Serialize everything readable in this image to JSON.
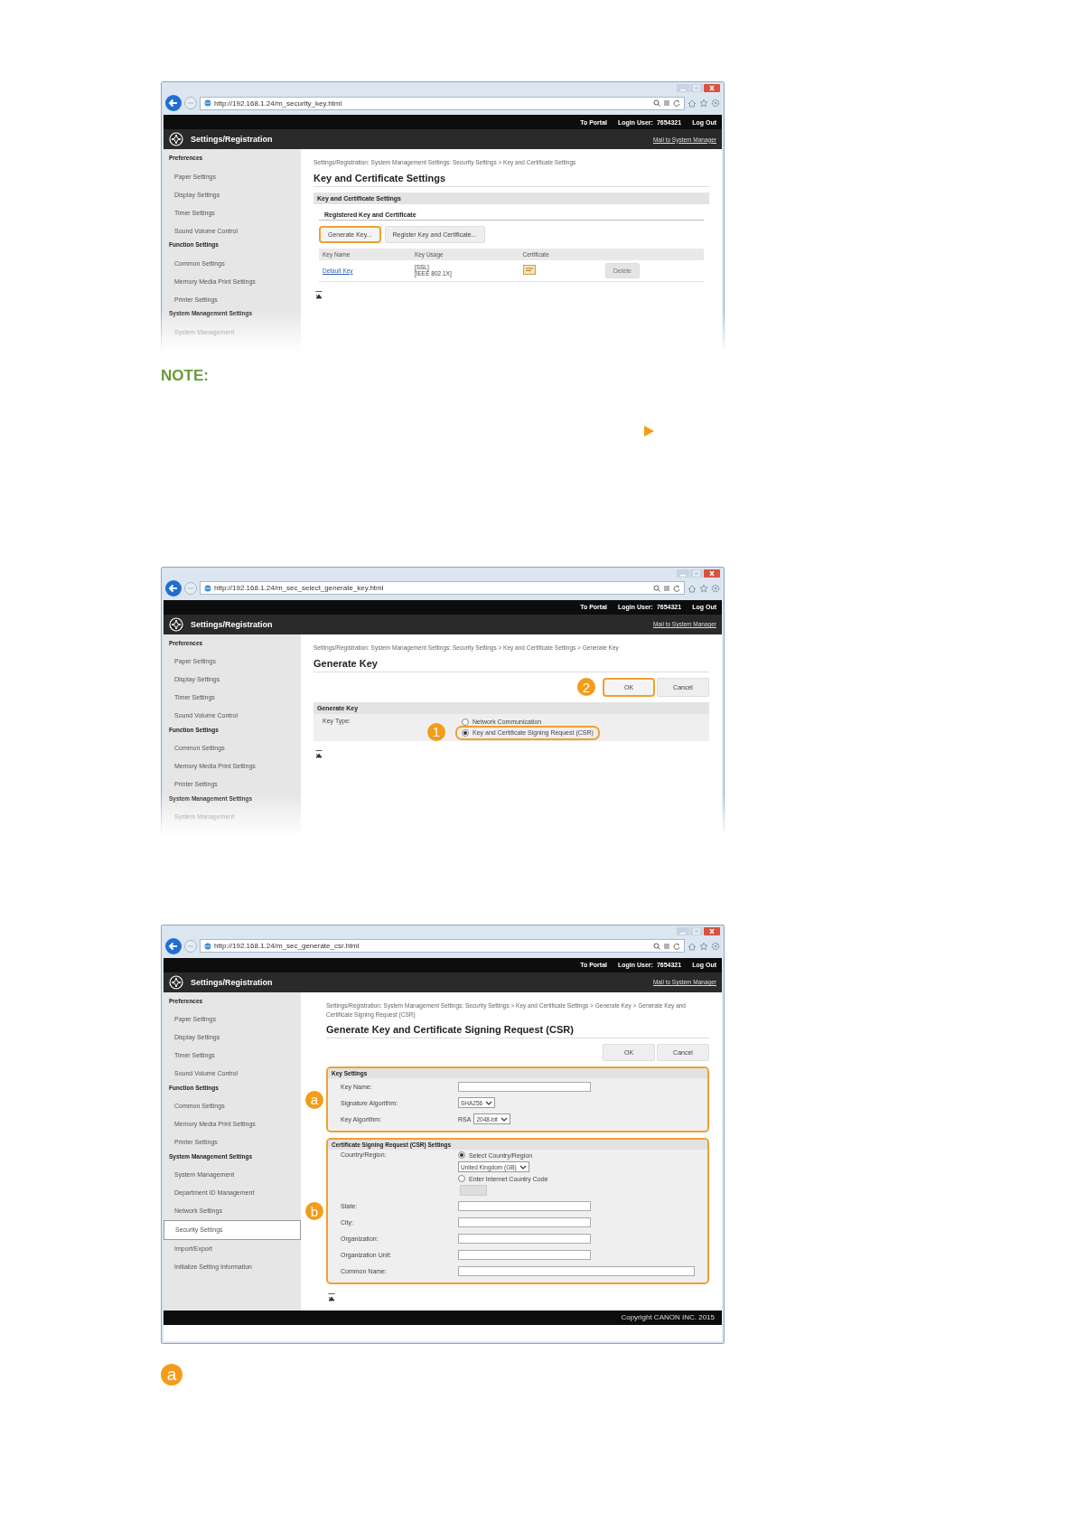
{
  "shots": [
    {
      "url": "http://192.168.1.24/m_security_key.html",
      "faded": true,
      "top_links": [
        "To Portal",
        "Log Out"
      ],
      "login_label": "Login User:",
      "login_id": "7654321",
      "app_title": "Settings/Registration",
      "mail_link": "Mail to System Manager",
      "sidebar": [
        {
          "text": "Preferences",
          "kind": "heading",
          "selected": false
        },
        {
          "text": "Paper Settings",
          "kind": "item",
          "selected": false
        },
        {
          "text": "Display Settings",
          "kind": "item",
          "selected": false
        },
        {
          "text": "Timer Settings",
          "kind": "item",
          "selected": false
        },
        {
          "text": "Sound Volume Control",
          "kind": "item",
          "selected": false
        },
        {
          "text": "Function Settings",
          "kind": "heading",
          "selected": false
        },
        {
          "text": "Common Settings",
          "kind": "item",
          "selected": false
        },
        {
          "text": "Memory Media Print Settings",
          "kind": "item",
          "selected": false
        },
        {
          "text": "Printer Settings",
          "kind": "item",
          "selected": false
        },
        {
          "text": "System Management Settings",
          "kind": "heading",
          "selected": false
        },
        {
          "text": "System Management",
          "kind": "item",
          "selected": false
        }
      ],
      "breadcrumb": "Settings/Registration: System Management Settings: Security Settings > Key and Certificate Settings",
      "title": "Key and Certificate Settings",
      "content": {
        "kind": "key_list",
        "section": "Key and Certificate Settings",
        "subsection": "Registered Key and Certificate",
        "buttons": [
          {
            "label": "Generate Key...",
            "highlighted": true
          },
          {
            "label": "Register Key and Certificate...",
            "highlighted": false
          }
        ],
        "columns": [
          "Key Name",
          "Key Usage",
          "Certificate"
        ],
        "rows": [
          {
            "key_name": "Default Key",
            "key_usage": [
              "[SSL]",
              "[IEEE 802.1X]"
            ],
            "delete": {
              "label": "Delete",
              "disabled": true
            }
          }
        ]
      }
    },
    {
      "url": "http://192.168.1.24/m_sec_select_generate_key.html",
      "faded": true,
      "top_links": [
        "To Portal",
        "Log Out"
      ],
      "login_label": "Login User:",
      "login_id": "7654321",
      "app_title": "Settings/Registration",
      "mail_link": "Mail to System Manager",
      "sidebar": [
        {
          "text": "Preferences",
          "kind": "heading",
          "selected": false
        },
        {
          "text": "Paper Settings",
          "kind": "item",
          "selected": false
        },
        {
          "text": "Display Settings",
          "kind": "item",
          "selected": false
        },
        {
          "text": "Timer Settings",
          "kind": "item",
          "selected": false
        },
        {
          "text": "Sound Volume Control",
          "kind": "item",
          "selected": false
        },
        {
          "text": "Function Settings",
          "kind": "heading",
          "selected": false
        },
        {
          "text": "Common Settings",
          "kind": "item",
          "selected": false
        },
        {
          "text": "Memory Media Print Settings",
          "kind": "item",
          "selected": false
        },
        {
          "text": "Printer Settings",
          "kind": "item",
          "selected": false
        },
        {
          "text": "System Management Settings",
          "kind": "heading",
          "selected": false
        },
        {
          "text": "System Management",
          "kind": "item",
          "selected": false
        }
      ],
      "breadcrumb": "Settings/Registration: System Management Settings: Security Settings > Key and Certificate Settings > Generate Key",
      "title": "Generate Key",
      "content": {
        "kind": "generate_key",
        "buttons": [
          {
            "label": "OK",
            "highlighted": true,
            "callout": "2"
          },
          {
            "label": "Cancel",
            "highlighted": false
          }
        ],
        "section": "Generate Key",
        "field_label": "Key Type:",
        "options": [
          {
            "label": "Network Communication",
            "selected": false,
            "highlighted": false
          },
          {
            "label": "Key and Certificate Signing Request (CSR)",
            "selected": true,
            "highlighted": true,
            "callout": "1"
          }
        ]
      }
    },
    {
      "url": "http://192.168.1.24/m_sec_generate_csr.html",
      "faded": false,
      "top_links": [
        "To Portal",
        "Log Out"
      ],
      "login_label": "Login User:",
      "login_id": "7654321",
      "app_title": "Settings/Registration",
      "mail_link": "Mail to System Manager",
      "sidebar": [
        {
          "text": "Preferences",
          "kind": "heading",
          "selected": false
        },
        {
          "text": "Paper Settings",
          "kind": "item",
          "selected": false
        },
        {
          "text": "Display Settings",
          "kind": "item",
          "selected": false
        },
        {
          "text": "Timer Settings",
          "kind": "item",
          "selected": false
        },
        {
          "text": "Sound Volume Control",
          "kind": "item",
          "selected": false
        },
        {
          "text": "Function Settings",
          "kind": "heading",
          "selected": false
        },
        {
          "text": "Common Settings",
          "kind": "item",
          "selected": false
        },
        {
          "text": "Memory Media Print Settings",
          "kind": "item",
          "selected": false
        },
        {
          "text": "Printer Settings",
          "kind": "item",
          "selected": false
        },
        {
          "text": "System Management Settings",
          "kind": "heading",
          "selected": false
        },
        {
          "text": "System Management",
          "kind": "item",
          "selected": false
        },
        {
          "text": "Department ID Management",
          "kind": "item",
          "selected": false
        },
        {
          "text": "Network Settings",
          "kind": "item",
          "selected": false
        },
        {
          "text": "Security Settings",
          "kind": "item",
          "selected": true
        },
        {
          "text": "Import/Export",
          "kind": "item",
          "selected": false
        },
        {
          "text": "Initialize Setting Information",
          "kind": "item",
          "selected": false
        }
      ],
      "breadcrumb": "Settings/Registration: System Management Settings: Security Settings > Key and Certificate Settings > Generate Key > Generate Key and Certificate Signing Request (CSR)",
      "title": "Generate Key and Certificate Signing Request (CSR)",
      "content": {
        "kind": "csr",
        "buttons": [
          {
            "label": "OK",
            "highlighted": false
          },
          {
            "label": "Cancel",
            "highlighted": false
          }
        ],
        "groups": [
          {
            "title": "Key Settings",
            "highlighted": true,
            "callout": "a",
            "rows": [
              {
                "label": "Key Name:",
                "kind": "text"
              },
              {
                "label": "Signature Algorithm:",
                "kind": "select",
                "value": "SHA256"
              },
              {
                "label": "Key Algorithm:",
                "kind": "select",
                "prefix": "RSA",
                "value": "2048-bit"
              }
            ]
          },
          {
            "title": "Certificate Signing Request (CSR) Settings",
            "highlighted": true,
            "callout": "b",
            "rows": [
              {
                "label": "Country/Region:",
                "kind": "country",
                "options": [
                  {
                    "label": "Select Country/Region",
                    "selected": true,
                    "value": "United Kingdom (GB)"
                  },
                  {
                    "label": "Enter Internet Country Code",
                    "selected": false
                  }
                ]
              },
              {
                "label": "State:",
                "kind": "text"
              },
              {
                "label": "City:",
                "kind": "text"
              },
              {
                "label": "Organization:",
                "kind": "text"
              },
              {
                "label": "Organization Unit:",
                "kind": "text"
              },
              {
                "label": "Common Name:",
                "kind": "wide_text"
              }
            ]
          }
        ]
      },
      "footer": "Copyright CANON INC. 2015"
    }
  ],
  "note": {
    "title": "NOTE:"
  },
  "bottom_marker": "a"
}
